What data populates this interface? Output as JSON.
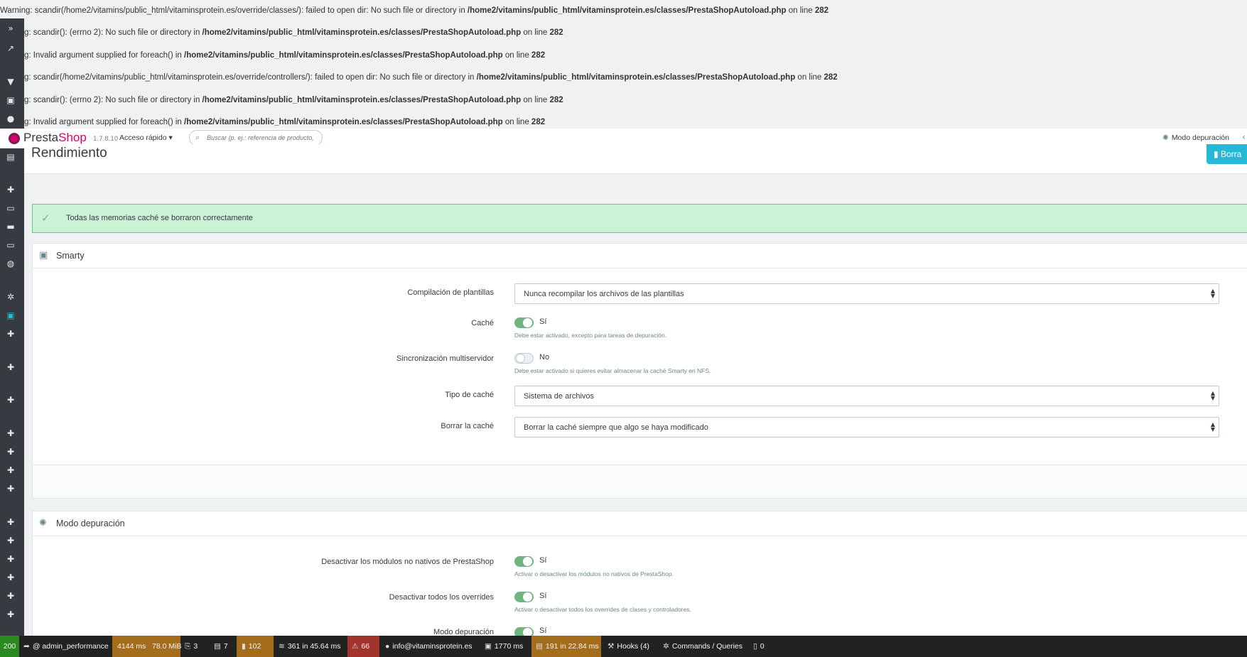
{
  "warnings": [
    {
      "prefix": "Warning",
      "msg": ": scandir(/home2/vitamins/public_html/vitaminsprotein.es/override/classes/): failed to open dir: No such file or directory in ",
      "file": "/home2/vitamins/public_html/vitaminsprotein.es/classes/PrestaShopAutoload.php",
      "tail": " on line ",
      "line": "282"
    },
    {
      "prefix": "g",
      "msg": ": scandir(): (errno 2): No such file or directory in ",
      "file": "/home2/vitamins/public_html/vitaminsprotein.es/classes/PrestaShopAutoload.php",
      "tail": " on line ",
      "line": "282"
    },
    {
      "prefix": "g",
      "msg": ": Invalid argument supplied for foreach() in ",
      "file": "/home2/vitamins/public_html/vitaminsprotein.es/classes/PrestaShopAutoload.php",
      "tail": " on line ",
      "line": "282"
    },
    {
      "prefix": "g",
      "msg": ": scandir(/home2/vitamins/public_html/vitaminsprotein.es/override/controllers/): failed to open dir: No such file or directory in ",
      "file": "/home2/vitamins/public_html/vitaminsprotein.es/classes/PrestaShopAutoload.php",
      "tail": " on line ",
      "line": "282"
    },
    {
      "prefix": "g",
      "msg": ": scandir(): (errno 2): No such file or directory in ",
      "file": "/home2/vitamins/public_html/vitaminsprotein.es/classes/PrestaShopAutoload.php",
      "tail": " on line ",
      "line": "282"
    },
    {
      "prefix": "g",
      "msg": ": Invalid argument supplied for foreach() in ",
      "file": "/home2/vitamins/public_html/vitaminsprotein.es/classes/PrestaShopAutoload.php",
      "tail": " on line ",
      "line": "282"
    }
  ],
  "header": {
    "logo_text_a": "Presta",
    "logo_text_b": "Shop",
    "version": "1.7.8.10",
    "quick_access": "Acceso rápido",
    "search_placeholder": "Buscar (p. ej.: referencia de producto,",
    "debug_mode": "Modo depuración"
  },
  "page": {
    "title": "Rendimiento",
    "clear_button": "Borra"
  },
  "alert": {
    "message": "Todas las memorias caché se borraron correctamente"
  },
  "smarty": {
    "title": "Smarty",
    "compile_label": "Compilación de plantillas",
    "compile_value": "Nunca recompilar los archivos de las plantillas",
    "cache_label": "Caché",
    "cache_state": "Sí",
    "cache_on": true,
    "cache_help": "Debe estar activado, excepto para tareas de depuración.",
    "multi_label": "Sincronización multiservidor",
    "multi_state": "No",
    "multi_on": false,
    "multi_help": "Debe estar activado si quieres evitar almacenar la caché Smarty en NFS.",
    "cache_type_label": "Tipo de caché",
    "cache_type_value": "Sistema de archivos",
    "clear_cache_label": "Borrar la caché",
    "clear_cache_value": "Borrar la caché siempre que algo se haya modificado"
  },
  "debug": {
    "title": "Modo depuración",
    "non_native_label": "Desactivar los módulos no nativos de PrestaShop",
    "non_native_state": "Sí",
    "non_native_help": "Activar o desactivar los módulos no nativos de PrestaShop.",
    "overrides_label": "Desactivar todos los overrides",
    "overrides_state": "Sí",
    "overrides_help": "Activar o desactivar todos los overrides de clases y controladores.",
    "debug_label": "Modo depuración",
    "debug_state": "Sí"
  },
  "toolbar": {
    "status": "200",
    "route": "@ admin_performance",
    "time": "4144 ms",
    "memory": "78.0 MiB",
    "forms": "3",
    "config": "7",
    "modules": "102",
    "sql": "361 in 45.64 ms",
    "errors": "66",
    "user": "info@vitaminsprotein.es",
    "render_time": "1770 ms",
    "cache": "191 in 22.84 ms",
    "hooks": "Hooks (4)",
    "commands": "Commands / Queries",
    "tb_last": "0"
  },
  "icons": {
    "sidebar": [
      "double-chevron-icon",
      "trending-icon",
      "basket-icon",
      "store-icon",
      "user-icon",
      "stats-icon",
      "puzzle-icon",
      "desktop-icon",
      "truck-icon",
      "card-icon",
      "globe-icon",
      "gear-icon",
      "advanced-icon",
      "puzzle-icon"
    ],
    "accent": "#25b9d7",
    "success_bg": "#cbf2d4",
    "toggle_on": "#70b580"
  }
}
